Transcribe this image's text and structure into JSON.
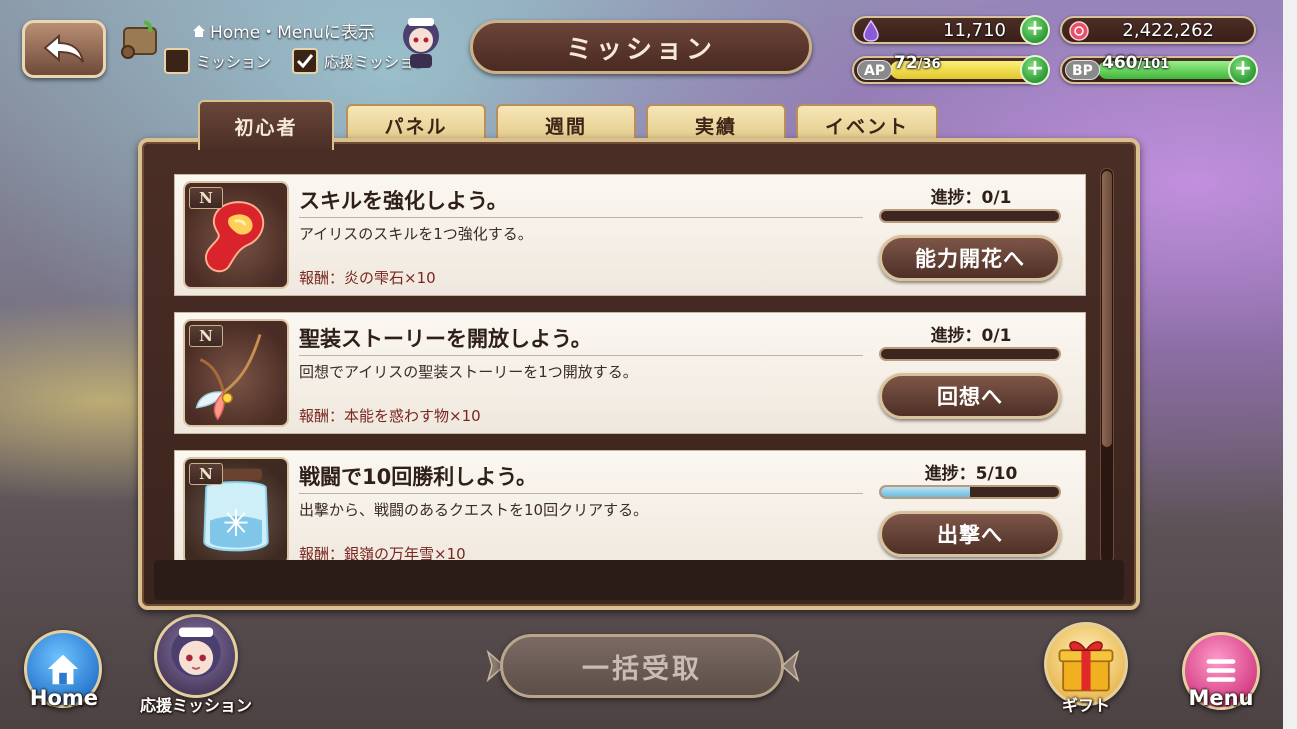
{
  "header": {
    "title": "ミッション",
    "display_label": "Home・Menuに表示",
    "checkbox_mission": {
      "label": "ミッション",
      "checked": false
    },
    "checkbox_support": {
      "label": "応援ミッション",
      "checked": true
    }
  },
  "resources": {
    "gems": "11,710",
    "gold": "2,422,262",
    "ap": {
      "tag": "AP",
      "current": "72",
      "max": "/36",
      "fill": 1.0
    },
    "bp": {
      "tag": "BP",
      "current": "460",
      "max": "/101",
      "fill": 1.0
    }
  },
  "tabs": [
    {
      "label": "初心者",
      "active": true
    },
    {
      "label": "パネル",
      "active": false
    },
    {
      "label": "週間",
      "active": false
    },
    {
      "label": "実績",
      "active": false
    },
    {
      "label": "イベント",
      "active": false
    }
  ],
  "missions": [
    {
      "rank": "N",
      "icon": "fire-drop-icon",
      "title": "スキルを強化しよう。",
      "description": "アイリスのスキルを1つ強化する。",
      "reward": "報酬：炎の雫石×10",
      "progress_label": "進捗：0/1",
      "progress": 0.0,
      "button": "能力開花へ"
    },
    {
      "rank": "N",
      "icon": "feather-charm-icon",
      "title": "聖装ストーリーを開放しよう。",
      "description": "回想でアイリスの聖装ストーリーを1つ開放する。",
      "reward": "報酬：本能を惑わす物×10",
      "progress_label": "進捗：0/1",
      "progress": 0.0,
      "button": "回想へ"
    },
    {
      "rank": "N",
      "icon": "snow-jar-icon",
      "title": "戦闘で10回勝利しよう。",
      "description": "出撃から、戦闘のあるクエストを10回クリアする。",
      "reward": "報酬：銀嶺の万年雪×10",
      "progress_label": "進捗：5/10",
      "progress": 0.5,
      "button": "出撃へ"
    }
  ],
  "bottom": {
    "home_label": "Home",
    "support_label": "応援ミッション",
    "bulk_receive": "一括受取",
    "gift_label": "ギフト",
    "menu_label": "Menu"
  },
  "colors": {
    "panel": "#4a2e26",
    "accent_gold": "#d9c08e",
    "progress_fill": "#6bbbe0",
    "ap_fill": "#f2e23a",
    "bp_fill": "#5fd04a"
  }
}
